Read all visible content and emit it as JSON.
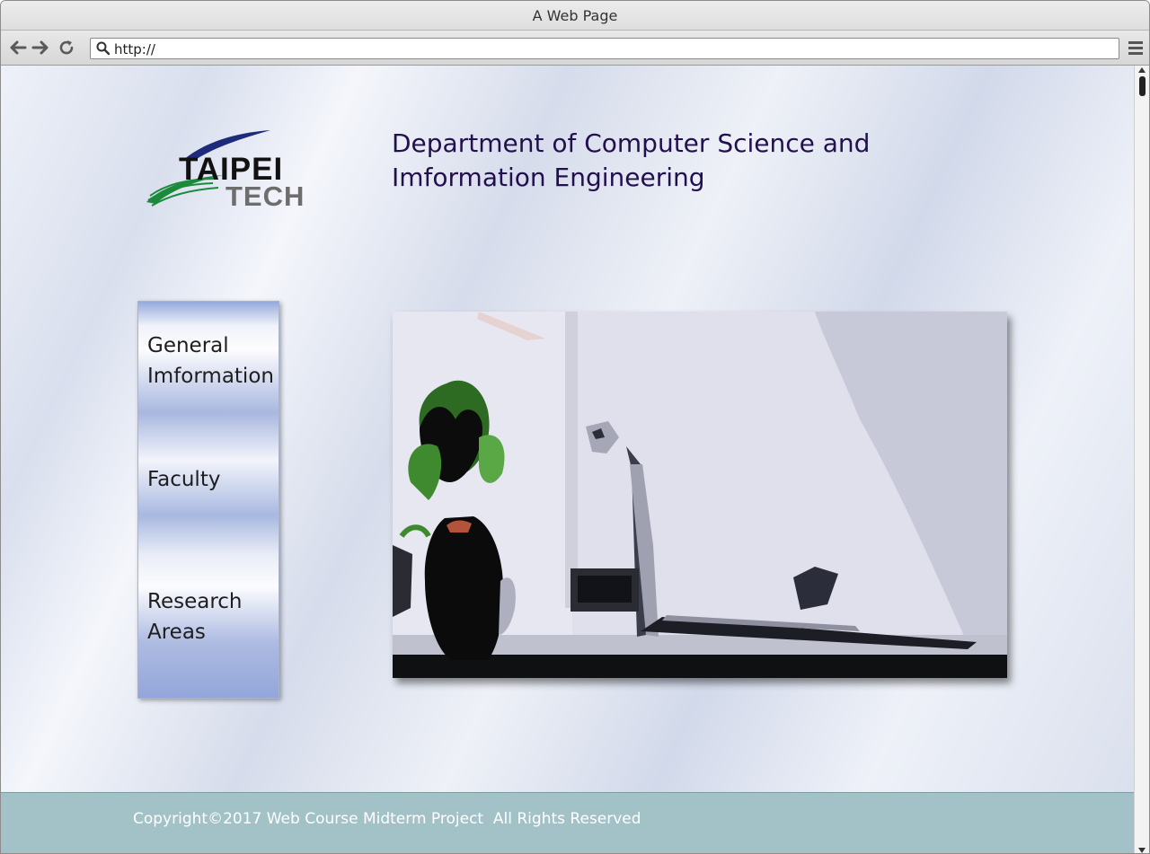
{
  "browser": {
    "title": "A Web Page",
    "url": "http://",
    "back_icon": "back-arrow-icon",
    "forward_icon": "forward-arrow-icon",
    "reload_icon": "reload-icon",
    "search_icon": "search-icon",
    "menu_icon": "hamburger-menu-icon"
  },
  "page": {
    "logo": {
      "line1": "TAIPEI",
      "line2": "TECH",
      "swoosh_colors": [
        "#1e2a7a",
        "#1b8a3a"
      ]
    },
    "department_title": "Department of Computer Science and Imformation Engineering",
    "sidenav": {
      "items": [
        {
          "label": "General Imformation"
        },
        {
          "label": "Faculty"
        },
        {
          "label": "Research Areas"
        }
      ]
    },
    "hero_image": "office-desk-photo",
    "footer": {
      "text": "Copyright©2017 Web Course Midterm Project  All Rights Reserved"
    }
  },
  "colors": {
    "title_text": "#22104e",
    "footer_bg": "#a2c2c8",
    "footer_text": "#ffffff"
  }
}
